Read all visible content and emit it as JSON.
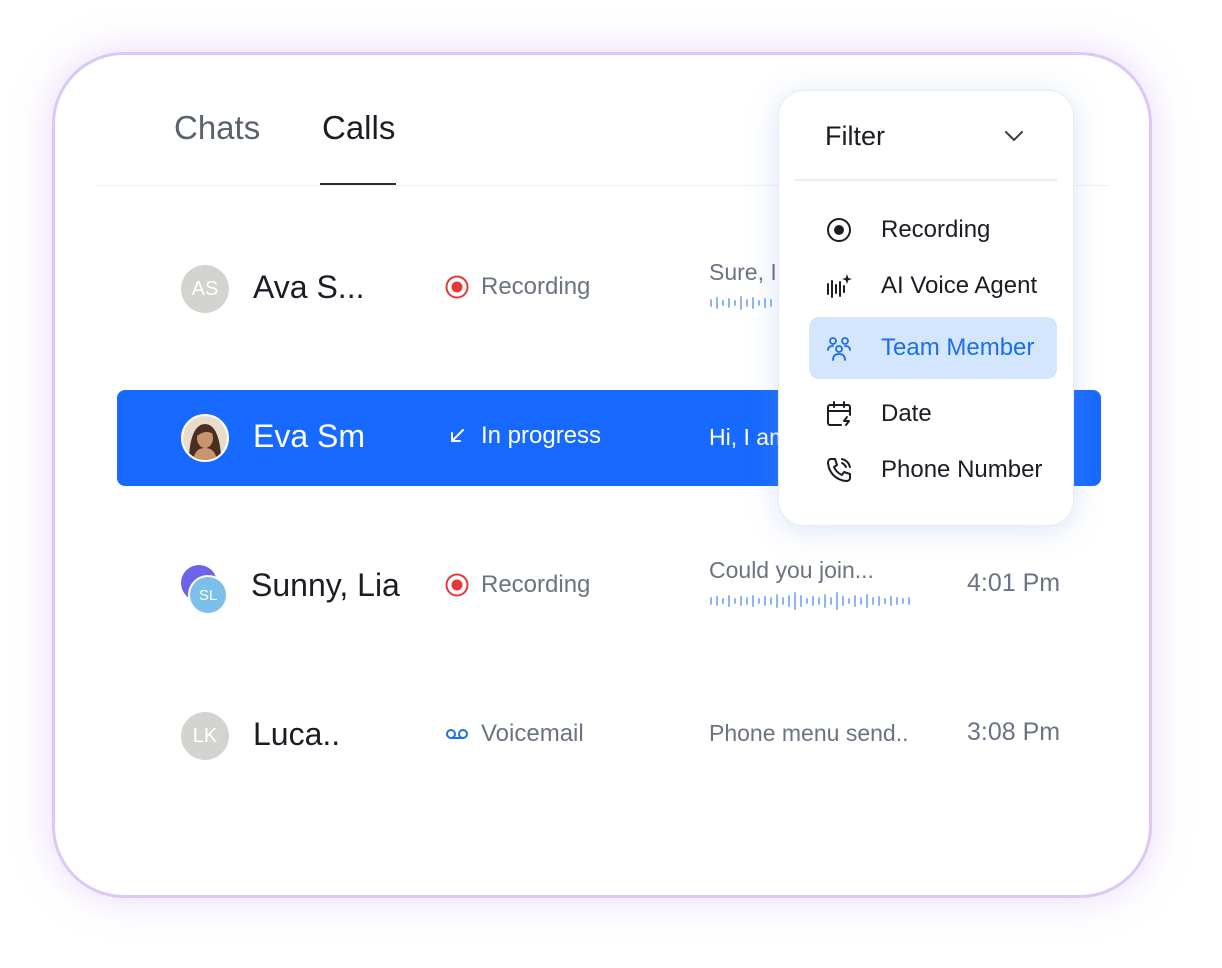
{
  "tabs": [
    {
      "label": "Chats",
      "active": false
    },
    {
      "label": "Calls",
      "active": true
    }
  ],
  "calls": [
    {
      "initials": "AS",
      "name": "Ava S...",
      "status": "Recording",
      "status_icon": "record-icon",
      "preview": "Sure, I",
      "time": ""
    },
    {
      "initials": "",
      "name": "Eva Sm",
      "status": "In progress",
      "status_icon": "arrow-down-left-icon",
      "preview": "Hi, I am",
      "time": "",
      "selected": true
    },
    {
      "initials": "SL",
      "name": "Sunny, Lia",
      "status": "Recording",
      "status_icon": "record-icon",
      "preview": "Could you join...",
      "time": "4:01 Pm"
    },
    {
      "initials": "LK",
      "name": "Luca..",
      "status": "Voicemail",
      "status_icon": "voicemail-icon",
      "preview": "Phone menu send..",
      "time": "3:08 Pm"
    }
  ],
  "filter": {
    "title": "Filter",
    "options": [
      {
        "label": "Recording",
        "icon": "record-circle-icon"
      },
      {
        "label": "AI Voice Agent",
        "icon": "ai-waveform-icon"
      },
      {
        "label": "Team Member",
        "icon": "team-icon",
        "active": true
      },
      {
        "label": "Date",
        "icon": "calendar-icon"
      },
      {
        "label": "Phone Number",
        "icon": "phone-icon"
      }
    ]
  },
  "colors": {
    "accent": "#1769ff",
    "recording_red": "#e5383b",
    "active_filter_bg": "#d4e6fd",
    "active_filter_text": "#1d6fe8",
    "card_border": "#dcc8f5"
  }
}
